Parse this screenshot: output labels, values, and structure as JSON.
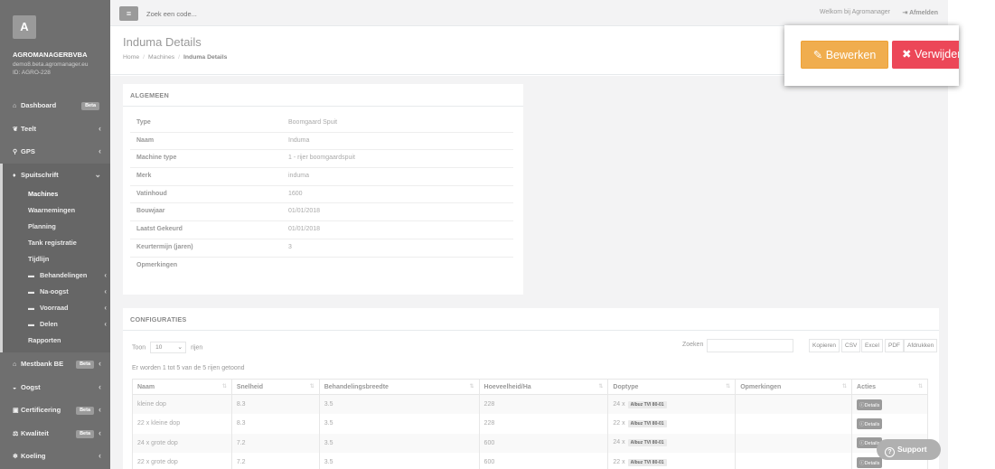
{
  "sidebar": {
    "avatar_letter": "A",
    "company": "AGROMANAGERBVBA",
    "domain": "demo8.beta.agromanager.eu",
    "id": "ID: AGRO-228",
    "items": [
      {
        "label": "Dashboard",
        "icon": "home-icon",
        "badge": "Beta"
      },
      {
        "label": "Teelt",
        "icon": "leaf-icon"
      },
      {
        "label": "GPS",
        "icon": "map-marker-icon"
      },
      {
        "label": "Spuitschrift",
        "icon": "tint-icon"
      }
    ],
    "sub_items": [
      {
        "label": "Machines"
      },
      {
        "label": "Waarnemingen"
      },
      {
        "label": "Planning"
      },
      {
        "label": "Tank registratie"
      },
      {
        "label": "Tijdlijn"
      },
      {
        "label": "Behandelingen",
        "icon": "folder-icon"
      },
      {
        "label": "Na-oogst",
        "icon": "folder-icon"
      },
      {
        "label": "Voorraad",
        "icon": "folder-icon"
      },
      {
        "label": "Delen",
        "icon": "folder-icon"
      },
      {
        "label": "Rapporten"
      }
    ],
    "items_after": [
      {
        "label": "Mestbank BE",
        "icon": "bank-icon",
        "badge": "Beta"
      },
      {
        "label": "Oogst",
        "icon": "harvest-icon"
      },
      {
        "label": "Certificering",
        "icon": "certificate-icon",
        "badge": "Beta"
      },
      {
        "label": "Kwaliteit",
        "icon": "balance-icon",
        "badge": "Beta"
      },
      {
        "label": "Koeling",
        "icon": "snowflake-icon"
      }
    ]
  },
  "topbar": {
    "menu_icon": "≡",
    "search_placeholder": "Zoek een code...",
    "welcome": "Welkom bij Agromanager",
    "logout": "Afmelden",
    "logout_icon": "⇥"
  },
  "heading": {
    "title": "Induma Details",
    "breadcrumb": [
      "Home",
      "Machines",
      "Induma Details"
    ]
  },
  "general": {
    "title": "ALGEMEEN",
    "rows": [
      {
        "key": "Type",
        "value": "Boomgaard Spuit"
      },
      {
        "key": "Naam",
        "value": "Induma"
      },
      {
        "key": "Machine type",
        "value": "1 - rijer boomgaardspuit"
      },
      {
        "key": "Merk",
        "value": "induma"
      },
      {
        "key": "Vatinhoud",
        "value": "1600"
      },
      {
        "key": "Bouwjaar",
        "value": "01/01/2018"
      },
      {
        "key": "Laatst Gekeurd",
        "value": "01/01/2018"
      },
      {
        "key": "Keurtermijn (jaren)",
        "value": "3"
      },
      {
        "key": "Opmerkingen",
        "value": ""
      }
    ]
  },
  "config": {
    "title": "CONFIGURATIES",
    "show_label": "Toon",
    "show_value": "10",
    "rows_label": "rijen",
    "search_label": "Zoeken",
    "export_buttons": [
      "Kopieren",
      "CSV",
      "Excel",
      "PDF",
      "Afdrukken"
    ],
    "info": "Er worden 1 tot 5 van de 5 rijen getoond",
    "columns": [
      "Naam",
      "Snelheid",
      "Behandelingsbreedte",
      "Hoeveelheid/Ha",
      "Doptype",
      "Opmerkingen",
      "Acties"
    ],
    "rows": [
      {
        "naam": "kleine dop",
        "snelheid": "8.3",
        "breedte": "3.5",
        "hoeveelheid": "228",
        "dop_count": "24 x",
        "dop_type": "Albuz TVI 80-01",
        "opmerkingen": "",
        "actie": "Details"
      },
      {
        "naam": "22 x kleine dop",
        "snelheid": "8.3",
        "breedte": "3.5",
        "hoeveelheid": "228",
        "dop_count": "22 x",
        "dop_type": "Albuz TVI 80-01",
        "opmerkingen": "",
        "actie": "Details"
      },
      {
        "naam": "24 x grote dop",
        "snelheid": "7.2",
        "breedte": "3.5",
        "hoeveelheid": "600",
        "dop_count": "24 x",
        "dop_type": "Albuz TVI 80-01",
        "opmerkingen": "",
        "actie": "Details"
      },
      {
        "naam": "22 x grote dop",
        "snelheid": "7.2",
        "breedte": "3.5",
        "hoeveelheid": "600",
        "dop_count": "22 x",
        "dop_type": "Albuz TVI 80-01",
        "opmerkingen": "",
        "actie": "Details"
      }
    ]
  },
  "popup": {
    "edit_label": "Bewerken",
    "edit_icon": "✎",
    "delete_label": "Verwijderen",
    "delete_icon": "✖"
  },
  "support": {
    "label": "Support",
    "icon": "?"
  },
  "colors": {
    "sidebar": "#6f6f6f",
    "edit": "#f0ad4e",
    "delete": "#ec4758",
    "background": "#f3f3f4"
  }
}
